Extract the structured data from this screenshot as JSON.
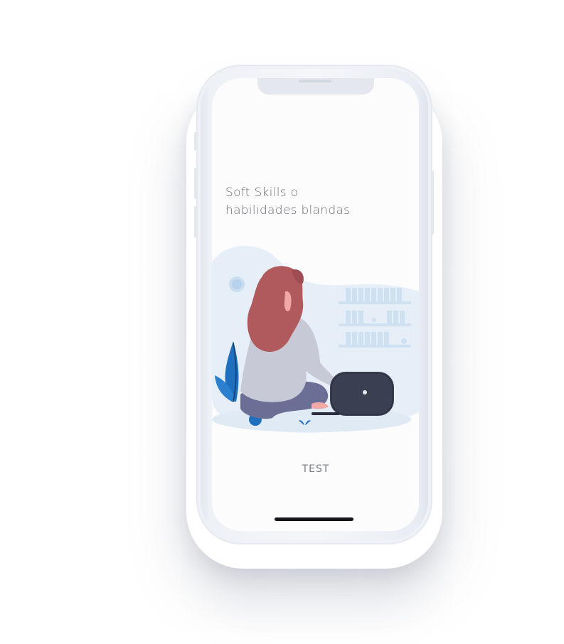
{
  "screen": {
    "headline_line1": "Soft Skills o",
    "headline_line2": "habilidades blandas",
    "action_label": "TEST",
    "illustration": "woman-sitting-with-laptop-illustration"
  },
  "colors": {
    "text": "#6a6d73",
    "button_text": "#7a7d83",
    "illustration_bg": "#e6eff7",
    "hair": "#b05a5e",
    "sweater": "#c7c9d6",
    "pants": "#6b6f95",
    "laptop": "#3b3f52",
    "plant": "#1f6fbf"
  }
}
